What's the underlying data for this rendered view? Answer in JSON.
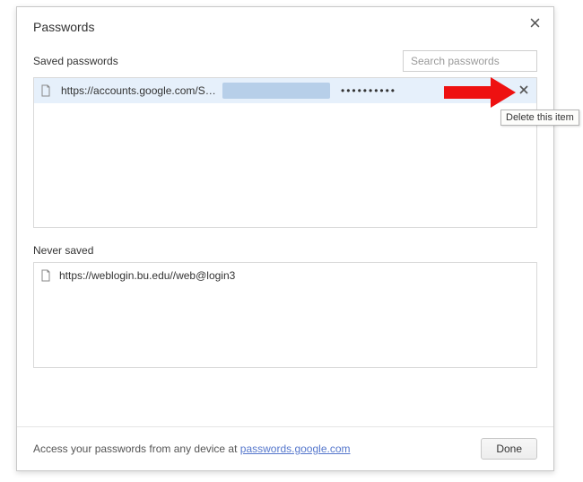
{
  "dialog": {
    "title": "Passwords",
    "close_icon": "×"
  },
  "saved": {
    "label": "Saved passwords",
    "search_placeholder": "Search passwords",
    "rows": [
      {
        "url": "https://accounts.google.com/Servic...",
        "password_mask": "••••••••••"
      }
    ]
  },
  "never": {
    "label": "Never saved",
    "rows": [
      {
        "url": "https://weblogin.bu.edu//web@login3"
      }
    ]
  },
  "footer": {
    "text_prefix": "Access your passwords from any device at ",
    "link_text": "passwords.google.com",
    "done_label": "Done"
  },
  "tooltip": "Delete this item"
}
